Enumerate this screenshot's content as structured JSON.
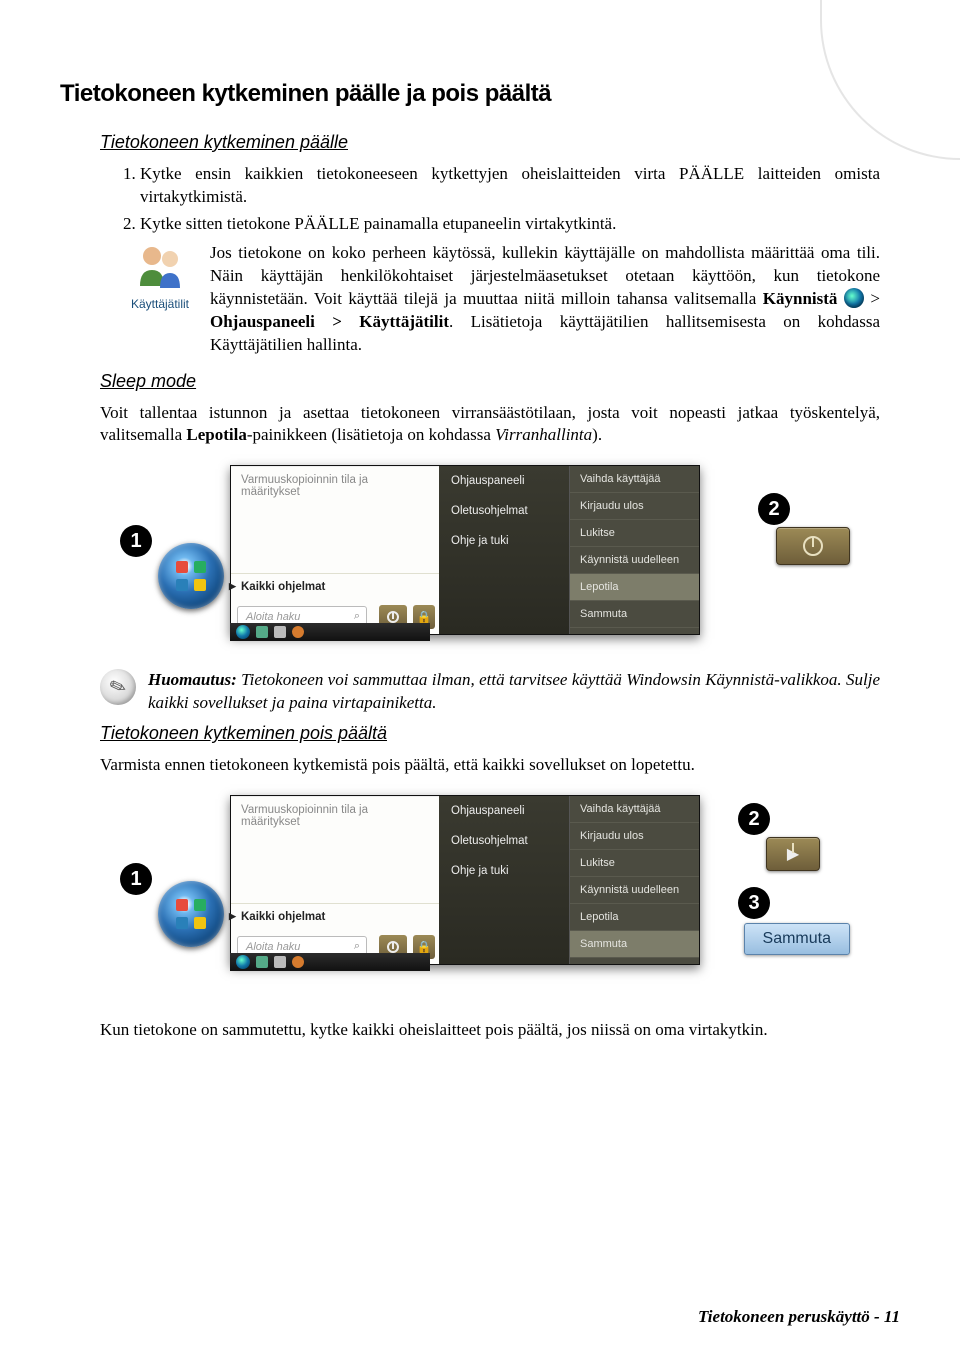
{
  "title": "Tietokoneen kytkeminen päälle ja pois päältä",
  "sub1": "Tietokoneen kytkeminen päälle",
  "step1": "Kytke ensin kaikkien tietokoneeseen kytkettyjen oheislaitteiden virta PÄÄLLE laitteiden omista virtakytkimistä.",
  "step2": "Kytke sitten tietokone PÄÄLLE painamalla etupaneelin virtakytkintä.",
  "usersCaption": "Käyttäjätilit",
  "usersText": {
    "p1": "Jos tietokone on koko perheen käytössä, kullekin käyttäjälle on mahdollista määrittää oma tili. Näin käyttäjän henkilökohtaiset järjestelmäasetukset otetaan käyttöön, kun tietokone käynnistetään. Voit käyttää tilejä ja muuttaa niitä milloin tahansa valitsemalla ",
    "b1": "Käynnistä ",
    "p2": " > ",
    "b2": "Ohjauspaneeli > Käyttäjätilit",
    "p3": ". Lisätietoja käyttäjätilien hallitsemisesta on kohdassa Käyttäjätilien hallinta."
  },
  "sub2": "Sleep mode",
  "sleepPara": {
    "p1": "Voit tallentaa istunnon ja asettaa tietokoneen virransäästötilaan, josta voit nopeasti jatkaa työskentelyä, valitsemalla ",
    "b1": "Lepotila",
    "p2": "-painikkeen (lisätietoja on kohdassa ",
    "i1": "Virranhallinta",
    "p3": ")."
  },
  "startMenu": {
    "leftTop": "Varmuuskopioinnin tila ja määritykset",
    "allProgs": "Kaikki ohjelmat",
    "searchPlaceholder": "Aloita haku",
    "mid": [
      "Ohjauspaneeli",
      "Oletusohjelmat",
      "Ohje ja tuki"
    ],
    "right": [
      "Vaihda käyttäjää",
      "Kirjaudu ulos",
      "Lukitse",
      "Käynnistä uudelleen",
      "Lepotila",
      "Sammuta"
    ]
  },
  "callouts": {
    "one": "1",
    "two": "2",
    "three": "3"
  },
  "note": {
    "lead": "Huomautus:",
    "body": " Tietokoneen voi sammuttaa ilman, että tarvitsee käyttää Windowsin Käynnistä-valikkoa. Sulje kaikki sovellukset ja paina virtapainiketta."
  },
  "sub3": "Tietokoneen kytkeminen pois päältä",
  "offPara": "Varmista ennen tietokoneen kytkemistä pois päältä, että kaikki sovellukset on lopetettu.",
  "shutdownButton": "Sammuta",
  "finalPara": "Kun tietokone on sammutettu, kytke kaikki oheislaitteet  pois päältä, jos niissä on oma virtakytkin.",
  "footer": "Tietokoneen peruskäyttö - 11"
}
